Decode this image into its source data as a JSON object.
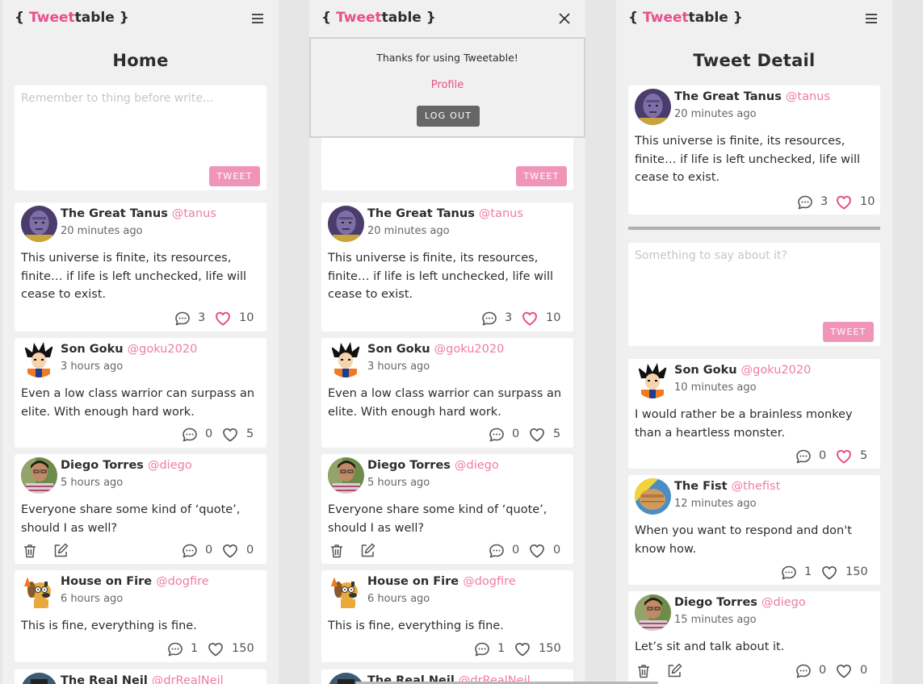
{
  "app": {
    "logo_open": "{ ",
    "logo_accent": "Twee",
    "logo_rest": "table }",
    "logo_t": "t"
  },
  "home": {
    "title": "Home",
    "compose_placeholder": "Remember to thing before write...",
    "tweet_button": "TWEET"
  },
  "menu": {
    "thanks": "Thanks for using Tweetable!",
    "profile": "Profile",
    "logout": "LOG OUT"
  },
  "tweets": [
    {
      "name": "The Great Tanus",
      "handle": "@tanus",
      "time": "20 minutes ago",
      "text": "This universe is finite, its resources, finite… if life is left unchecked, life will cease to exist.",
      "comments": "3",
      "likes": "10",
      "liked": true,
      "own": false,
      "avatar": "thanos-avatar"
    },
    {
      "name": "Son Goku",
      "handle": "@goku2020",
      "time": "3 hours ago",
      "text": "Even a low class warrior can surpass an elite. With enough hard work.",
      "comments": "0",
      "likes": "5",
      "liked": false,
      "own": false,
      "avatar": "goku-avatar"
    },
    {
      "name": "Diego Torres",
      "handle": "@diego",
      "time": "5 hours ago",
      "text": "Everyone share some kind of ‘quote’, should I as well?",
      "comments": "0",
      "likes": "0",
      "liked": false,
      "own": true,
      "avatar": "diego-avatar"
    },
    {
      "name": "House on Fire",
      "handle": "@dogfire",
      "time": "6 hours ago",
      "text": "This is fine, everything is fine.",
      "comments": "1",
      "likes": "150",
      "liked": false,
      "own": false,
      "avatar": "dog-avatar"
    },
    {
      "name": "The Real Neil",
      "handle": "@drRealNeil",
      "time": "",
      "text": "",
      "comments": "",
      "likes": "",
      "liked": false,
      "own": false,
      "avatar": "neil-avatar"
    }
  ],
  "detail": {
    "title": "Tweet Detail",
    "main": {
      "name": "The Great Tanus",
      "handle": "@tanus",
      "time": "20 minutes ago",
      "text": "This universe is finite, its resources, finite… if life is left unchecked, life will cease to exist.",
      "comments": "3",
      "likes": "10"
    },
    "reply_placeholder": "Something to say about it?",
    "tweet_button": "TWEET",
    "replies": [
      {
        "name": "Son Goku",
        "handle": "@goku2020",
        "time": "10 minutes ago",
        "text": "I would rather be a brainless monkey than a heartless monster.",
        "comments": "0",
        "likes": "5",
        "liked": true,
        "own": false,
        "avatar": "goku-avatar"
      },
      {
        "name": "The Fist",
        "handle": "@thefist",
        "time": "12 minutes ago",
        "text": "When you want to respond and don't know how.",
        "comments": "1",
        "likes": "150",
        "liked": false,
        "own": false,
        "avatar": "fist-avatar"
      },
      {
        "name": "Diego Torres",
        "handle": "@diego",
        "time": "15 minutes ago",
        "text": "Let’s sit and talk about it.",
        "comments": "0",
        "likes": "0",
        "liked": false,
        "own": true,
        "avatar": "diego-avatar"
      }
    ]
  },
  "colors": {
    "accent": "#e94f8a",
    "button": "#f095b8",
    "handle": "#f07ba8",
    "panel": "#f0f0f0",
    "background": "#e6e6e6"
  }
}
